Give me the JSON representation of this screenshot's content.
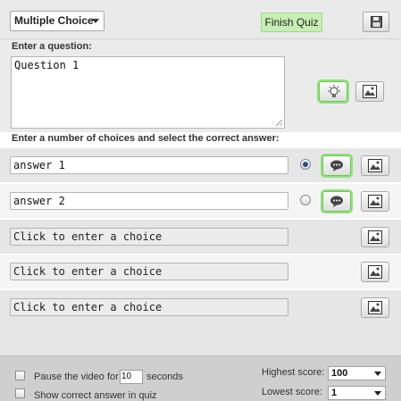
{
  "toolbar": {
    "question_type": "Multiple Choice",
    "finish_label": "Finish Quiz",
    "save_icon": "save-icon"
  },
  "question": {
    "label": "Enter a question:",
    "value": "Question 1",
    "hint_icon": "lightbulb-icon",
    "image_icon": "image-icon"
  },
  "choices": {
    "label": "Enter a number of choices and select the correct answer:",
    "items": [
      {
        "value": "answer 1",
        "placeholder": "",
        "correct": true,
        "feedback_icon": "speech-bubble-icon"
      },
      {
        "value": "answer 2",
        "placeholder": "",
        "correct": false,
        "feedback_icon": "speech-bubble-icon"
      },
      {
        "value": "",
        "placeholder": "Click to enter a choice"
      },
      {
        "value": "",
        "placeholder": "Click to enter a choice"
      },
      {
        "value": "",
        "placeholder": "Click to enter a choice"
      }
    ]
  },
  "footer": {
    "pause_label_before": "Pause the video for",
    "pause_seconds": "10",
    "pause_label_after": "seconds",
    "show_answer_label": "Show correct answer in quiz",
    "highest_label": "Highest score:",
    "highest_value": "100",
    "lowest_label": "Lowest score:",
    "lowest_value": "1"
  },
  "colors": {
    "finish_button_bg": "#c6f0b3",
    "glow": "#8fe27a",
    "radio_selected": "#2a4f86"
  }
}
